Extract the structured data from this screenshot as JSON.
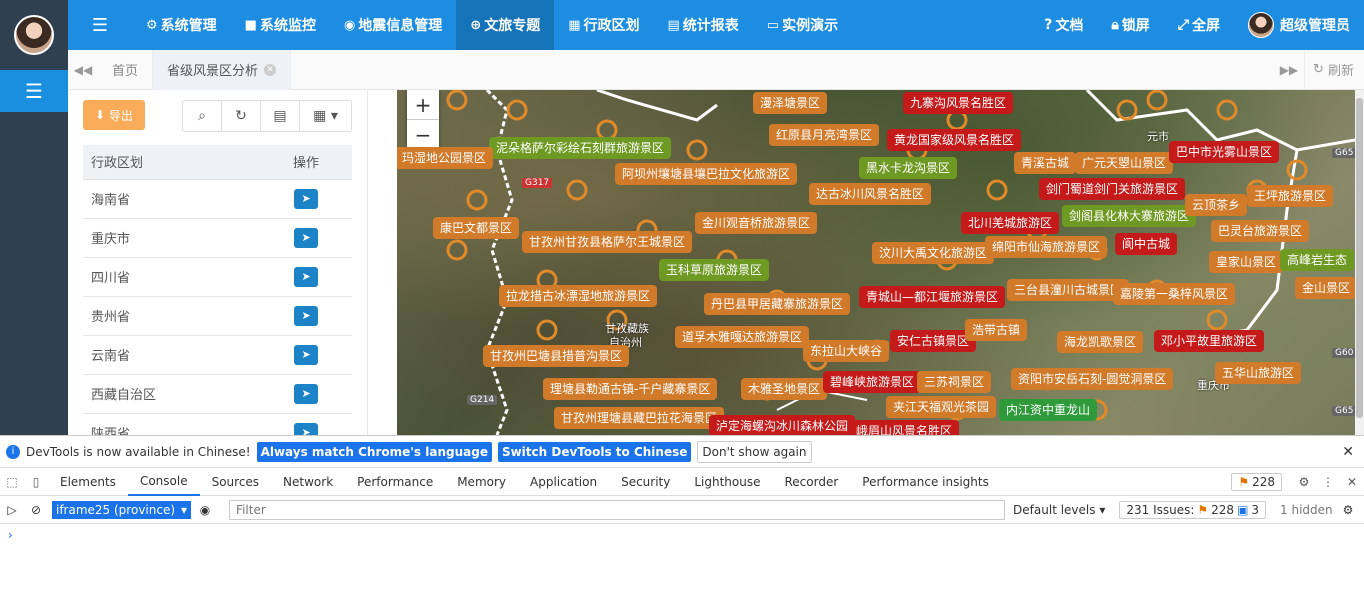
{
  "topnav": [
    {
      "icon": "⚙",
      "label": "系统管理"
    },
    {
      "icon": "■",
      "label": "系统监控"
    },
    {
      "icon": "◉",
      "label": "地震信息管理"
    },
    {
      "icon": "⊕",
      "label": "文旅专题",
      "active": true
    },
    {
      "icon": "▦",
      "label": "行政区划"
    },
    {
      "icon": "▤",
      "label": "统计报表"
    },
    {
      "icon": "▭",
      "label": "实例演示"
    }
  ],
  "topright": {
    "doc": "文档",
    "lock": "锁屏",
    "fullscreen": "全屏",
    "user": "超级管理员"
  },
  "tabs": {
    "home": "首页",
    "current": "省级风景区分析",
    "refresh": "刷新"
  },
  "panel": {
    "export": "导出",
    "col_region": "行政区划",
    "col_op": "操作",
    "rows": [
      "海南省",
      "重庆市",
      "四川省",
      "贵州省",
      "云南省",
      "西藏自治区",
      "陕西省"
    ]
  },
  "map": {
    "labels": [
      {
        "t": "泥朵格萨尔彩绘石刻群旅游景区",
        "c": "g"
      },
      {
        "t": "阿坝州壤塘县壤巴拉文化旅游区",
        "c": "o"
      },
      {
        "t": "康巴文都景区",
        "c": "o"
      },
      {
        "t": "甘孜州甘孜县格萨尔王城景区",
        "c": "o"
      },
      {
        "t": "金川观音桥旅游景区",
        "c": "o"
      },
      {
        "t": "玉科草原旅游景区",
        "c": "g"
      },
      {
        "t": "拉龙措古冰漂湿地旅游景区",
        "c": "o"
      },
      {
        "t": "丹巴县甲居藏寨旅游景区",
        "c": "o"
      },
      {
        "t": "道孚木雅嘎达旅游景区",
        "c": "o"
      },
      {
        "t": "甘孜州巴塘县措普沟景区",
        "c": "o"
      },
      {
        "t": "东拉山大峡谷",
        "c": "o"
      },
      {
        "t": "理塘县勒通古镇-千户藏寨景区",
        "c": "o"
      },
      {
        "t": "木雅圣地景区",
        "c": "o"
      },
      {
        "t": "甘孜州理塘县藏巴拉花海景区",
        "c": "o"
      },
      {
        "t": "泸定海螺沟冰川森林公园",
        "c": "r"
      },
      {
        "t": "漫泽塘景区",
        "c": "o"
      },
      {
        "t": "红原县月亮湾景区",
        "c": "o"
      },
      {
        "t": "九寨沟风景名胜区",
        "c": "r"
      },
      {
        "t": "黄龙国家级风景名胜区",
        "c": "r"
      },
      {
        "t": "黑水卡龙沟景区",
        "c": "g"
      },
      {
        "t": "达古冰川风景名胜区",
        "c": "o"
      },
      {
        "t": "汶川大禹文化旅游区",
        "c": "o"
      },
      {
        "t": "北川羌城旅游区",
        "c": "r"
      },
      {
        "t": "绵阳市仙海旅游景区",
        "c": "o"
      },
      {
        "t": "青城山—都江堰旅游景区",
        "c": "r"
      },
      {
        "t": "安仁古镇景区",
        "c": "r"
      },
      {
        "t": "碧峰峡旅游景区",
        "c": "r"
      },
      {
        "t": "三苏祠景区",
        "c": "o"
      },
      {
        "t": "夹江天福观光茶园",
        "c": "o"
      },
      {
        "t": "峨眉山风景名胜区",
        "c": "r"
      },
      {
        "t": "青溪古城",
        "c": "o"
      },
      {
        "t": "广元天曌山景区",
        "c": "o"
      },
      {
        "t": "剑门蜀道剑门关旅游景区",
        "c": "r"
      },
      {
        "t": "剑阁县化林大寨旅游区",
        "c": "g"
      },
      {
        "t": "阆中古城",
        "c": "r"
      },
      {
        "t": "三台县潼川古城景区",
        "c": "o"
      },
      {
        "t": "浩带古镇",
        "c": "o"
      },
      {
        "t": "海龙凯歌景区",
        "c": "o"
      },
      {
        "t": "资阳市安岳石刻-圆觉洞景区",
        "c": "o"
      },
      {
        "t": "内江资中重龙山",
        "c": "dg"
      },
      {
        "t": "嘉陵第一桑梓风景区",
        "c": "o"
      },
      {
        "t": "邓小平故里旅游区",
        "c": "r"
      },
      {
        "t": "五华山旅游区",
        "c": "o"
      },
      {
        "t": "巴中市光雾山景区",
        "c": "r"
      },
      {
        "t": "王坪旅游景区",
        "c": "o"
      },
      {
        "t": "云顶茶乡",
        "c": "o"
      },
      {
        "t": "巴灵台旅游景区",
        "c": "o"
      },
      {
        "t": "皇家山景区",
        "c": "o"
      },
      {
        "t": "高峰岩生态",
        "c": "g"
      },
      {
        "t": "金山景区",
        "c": "o"
      },
      {
        "t": "玛湿地公园景区",
        "c": "o"
      }
    ],
    "text": {
      "ganzi": "甘孜藏族",
      "ganzi2": "自治州",
      "chongqing": "重庆市",
      "yuan": "元市"
    },
    "badges": {
      "g317": "G317",
      "g214": "G214",
      "g65": "G65",
      "g60": "G60",
      "g65b": "G65"
    }
  },
  "devtools": {
    "notice": "DevTools is now available in Chinese!",
    "btn_match": "Always match Chrome's language",
    "btn_switch": "Switch DevTools to Chinese",
    "btn_dont": "Don't show again",
    "tabs": [
      "Elements",
      "Console",
      "Sources",
      "Network",
      "Performance",
      "Memory",
      "Application",
      "Security",
      "Lighthouse",
      "Recorder",
      "Performance insights"
    ],
    "warn_count": "228",
    "context": "iframe25 (province)",
    "filter_placeholder": "Filter",
    "levels": "Default levels",
    "issues": "231 Issues:",
    "issues_warn": "228",
    "issues_info": "3",
    "hidden": "1 hidden",
    "prompt": "›"
  }
}
